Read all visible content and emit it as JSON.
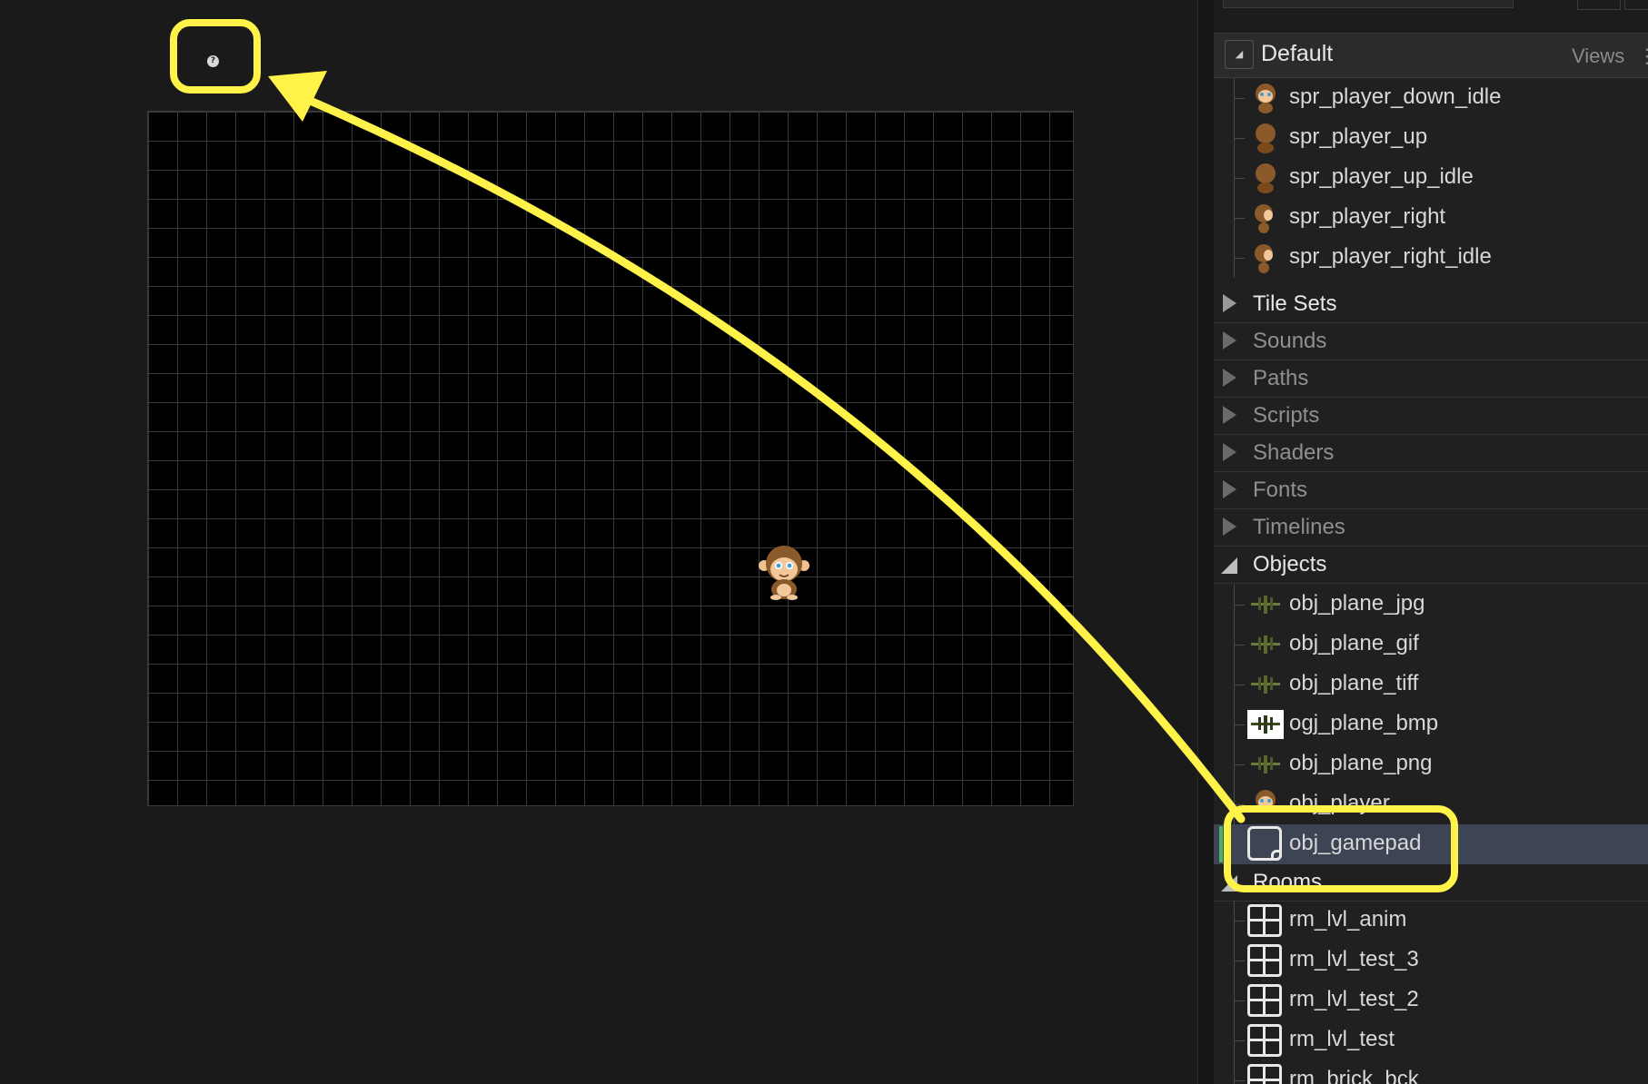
{
  "asset_browser": {
    "group_name": "Default",
    "views_label": "Views",
    "views_menu_glyph": "⋮",
    "sprites": [
      {
        "label": "spr_player_down_idle",
        "icon": "monkey-front-sprite"
      },
      {
        "label": "spr_player_up",
        "icon": "monkey-back-sprite"
      },
      {
        "label": "spr_player_up_idle",
        "icon": "monkey-back-sprite"
      },
      {
        "label": "spr_player_right",
        "icon": "monkey-side-sprite"
      },
      {
        "label": "spr_player_right_idle",
        "icon": "monkey-side-sprite"
      }
    ],
    "categories": {
      "tile_sets": "Tile Sets",
      "sounds": "Sounds",
      "paths": "Paths",
      "scripts": "Scripts",
      "shaders": "Shaders",
      "fonts": "Fonts",
      "timelines": "Timelines",
      "objects": "Objects",
      "rooms": "Rooms"
    },
    "objects": [
      {
        "label": "obj_plane_jpg",
        "icon": "plane-sprite"
      },
      {
        "label": "obj_plane_gif",
        "icon": "plane-sprite"
      },
      {
        "label": "obj_plane_tiff",
        "icon": "plane-sprite"
      },
      {
        "label": "ogj_plane_bmp",
        "icon": "plane-sprite-white-bg"
      },
      {
        "label": "obj_plane_png",
        "icon": "plane-sprite"
      },
      {
        "label": "obj_player",
        "icon": "monkey-front-sprite"
      },
      {
        "label": "obj_gamepad",
        "icon": "object-icon",
        "selected": true
      }
    ],
    "rooms": [
      {
        "label": "rm_lvl_anim",
        "icon": "room-icon"
      },
      {
        "label": "rm_lvl_test_3",
        "icon": "room-icon"
      },
      {
        "label": "rm_lvl_test_2",
        "icon": "room-icon"
      },
      {
        "label": "rm_lvl_test",
        "icon": "room-icon"
      },
      {
        "label": "rm_brick_bck",
        "icon": "room-icon"
      }
    ]
  },
  "room_editor": {
    "instances": [
      {
        "name": "obj_gamepad",
        "glyph": "?",
        "icon": "unknown-sprite-icon"
      },
      {
        "name": "obj_player",
        "icon": "monkey-front-sprite"
      }
    ]
  },
  "colors": {
    "highlight": "#fff34a",
    "selection": "#3d4454",
    "selection_bar": "#4caf6a",
    "canvas": "#000000",
    "grid": "#3a3a3a"
  }
}
